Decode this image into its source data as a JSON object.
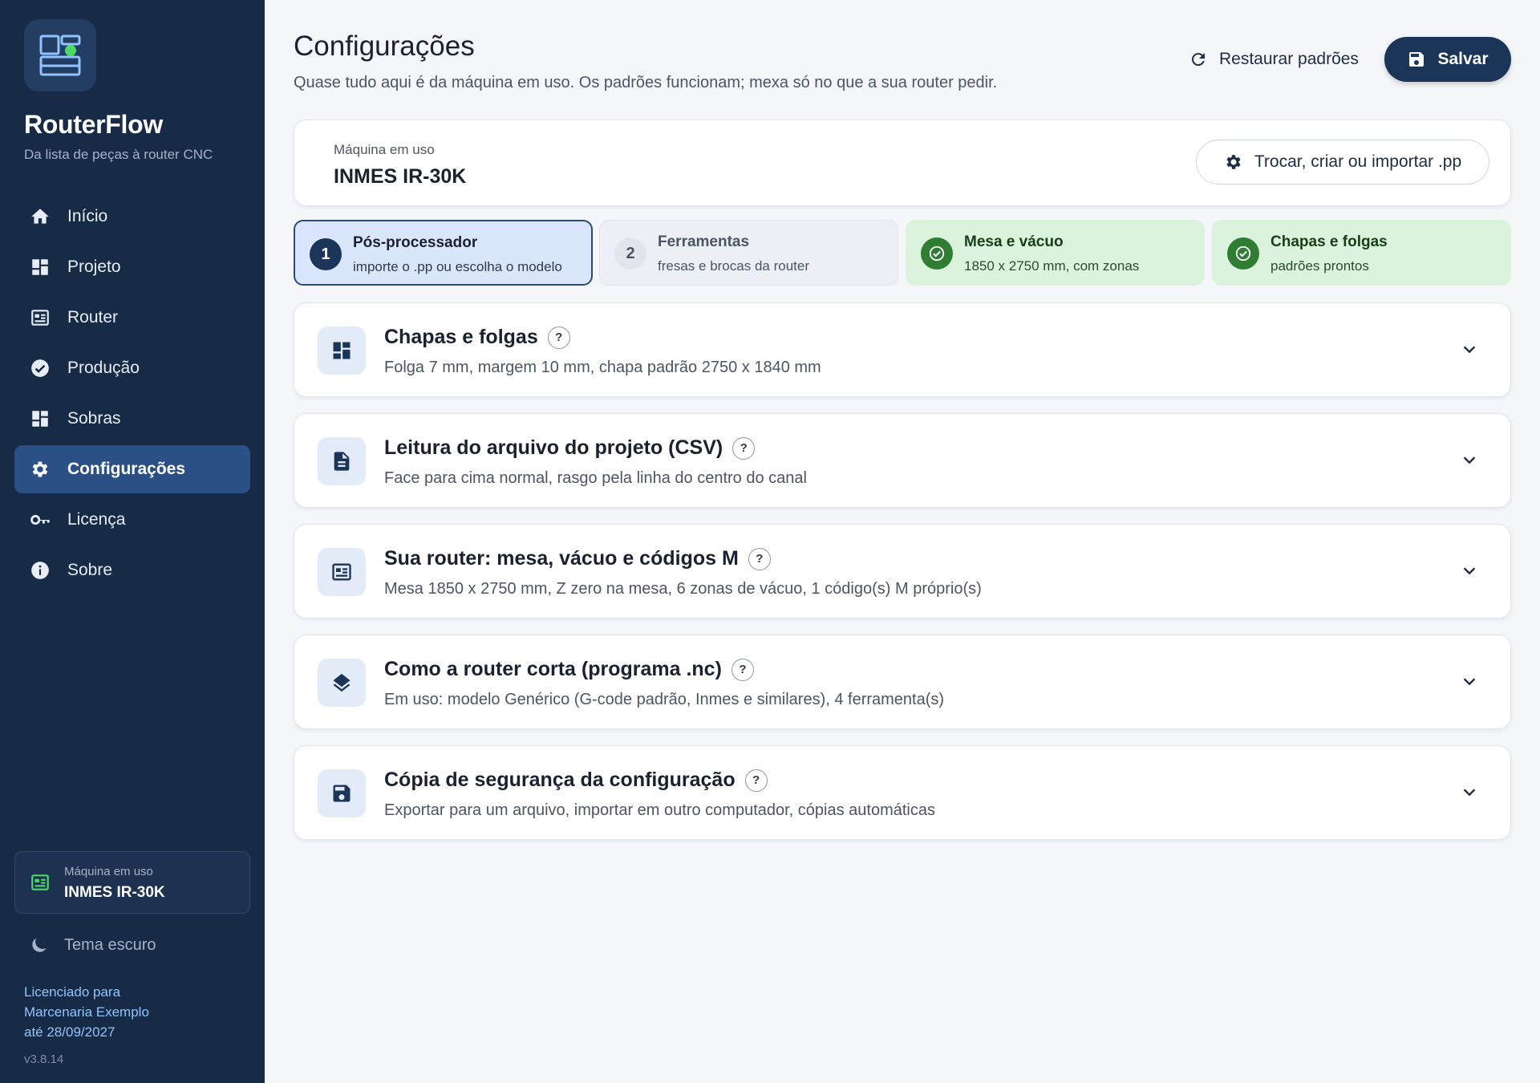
{
  "sidebar": {
    "brand": "RouterFlow",
    "tagline": "Da lista de peças à router CNC",
    "nav": [
      {
        "label": "Início",
        "icon": "home-icon"
      },
      {
        "label": "Projeto",
        "icon": "dashboard-icon"
      },
      {
        "label": "Router",
        "icon": "router-icon"
      },
      {
        "label": "Produção",
        "icon": "check-circle-icon"
      },
      {
        "label": "Sobras",
        "icon": "dashboard-icon"
      },
      {
        "label": "Configurações",
        "icon": "gear-icon",
        "active": true
      },
      {
        "label": "Licença",
        "icon": "key-icon"
      },
      {
        "label": "Sobre",
        "icon": "info-icon"
      }
    ],
    "machine_label": "Máquina em uso",
    "machine_value": "INMES IR-30K",
    "theme_label": "Tema escuro",
    "license_line1": "Licenciado para",
    "license_line2": "Marcenaria Exemplo",
    "license_line3": "até 28/09/2027",
    "version": "v3.8.14"
  },
  "header": {
    "title": "Configurações",
    "subtitle": "Quase tudo aqui é da máquina em uso. Os padrões funcionam; mexa só no que a sua router pedir.",
    "restore_label": "Restaurar padrões",
    "save_label": "Salvar"
  },
  "machine_card": {
    "label": "Máquina em uso",
    "value": "INMES IR-30K",
    "swap_label": "Trocar, criar ou importar .pp"
  },
  "steps": [
    {
      "badge": "1",
      "title": "Pós-processador",
      "subtitle": "importe o .pp ou escolha o modelo",
      "state": "active"
    },
    {
      "badge": "2",
      "title": "Ferramentas",
      "subtitle": "fresas e brocas da router",
      "state": "pending"
    },
    {
      "badge": "",
      "title": "Mesa e vácuo",
      "subtitle": "1850 x 2750 mm, com zonas",
      "state": "done"
    },
    {
      "badge": "",
      "title": "Chapas e folgas",
      "subtitle": "padrões prontos",
      "state": "done"
    }
  ],
  "sections": [
    {
      "title": "Chapas e folgas",
      "subtitle": "Folga 7 mm, margem 10 mm, chapa padrão 2750 x 1840 mm",
      "icon": "dashboard-icon"
    },
    {
      "title": "Leitura do arquivo do projeto (CSV)",
      "subtitle": "Face para cima normal, rasgo pela linha do centro do canal",
      "icon": "document-icon"
    },
    {
      "title": "Sua router: mesa, vácuo e códigos M",
      "subtitle": "Mesa 1850 x 2750 mm, Z zero na mesa, 6 zonas de vácuo, 1 código(s) M próprio(s)",
      "icon": "router-icon"
    },
    {
      "title": "Como a router corta (programa .nc)",
      "subtitle": "Em uso: modelo Genérico (G-code padrão, Inmes e similares), 4 ferramenta(s)",
      "icon": "layers-icon"
    },
    {
      "title": "Cópia de segurança da configuração",
      "subtitle": "Exportar para um arquivo, importar em outro computador, cópias automáticas",
      "icon": "floppy-icon"
    }
  ],
  "help_mark": "?",
  "colors": {
    "sidebar_bg": "#172a46",
    "accent": "#1b3558",
    "active_nav": "#2b5086",
    "success": "#2e7d32",
    "success_bg": "#dbf3dd",
    "step_active_bg": "#dae6fb",
    "machine_icon": "#4cd964"
  }
}
